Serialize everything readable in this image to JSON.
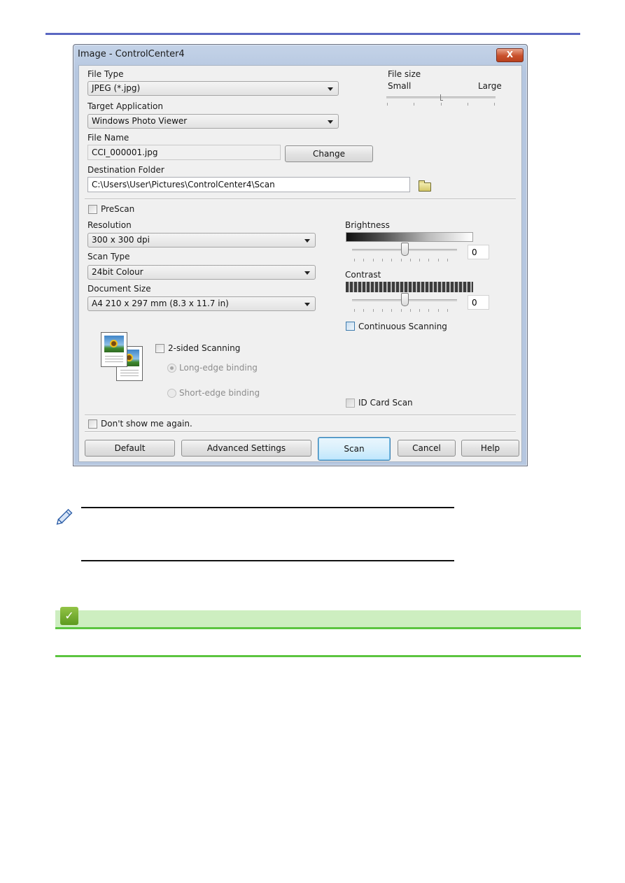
{
  "dialog": {
    "title": "Image - ControlCenter4",
    "close_label": "X",
    "file_type": {
      "label": "File Type",
      "value": "JPEG (*.jpg)"
    },
    "file_size": {
      "label": "File size",
      "min_label": "Small",
      "max_label": "Large",
      "level_fraction": 0.5
    },
    "target_application": {
      "label": "Target Application",
      "value": "Windows Photo Viewer"
    },
    "file_name": {
      "label": "File Name",
      "value": "CCI_000001.jpg",
      "change_button": "Change"
    },
    "destination_folder": {
      "label": "Destination Folder",
      "value": "C:\\Users\\User\\Pictures\\ControlCenter4\\Scan",
      "browse_icon": "folder-icon"
    },
    "prescan": {
      "label": "PreScan",
      "checked": false
    },
    "resolution": {
      "label": "Resolution",
      "value": "300 x 300 dpi"
    },
    "scan_type": {
      "label": "Scan Type",
      "value": "24bit Colour"
    },
    "document_size": {
      "label": "Document Size",
      "value": "A4 210 x 297 mm (8.3 x 11.7 in)"
    },
    "brightness": {
      "label": "Brightness",
      "value": "0",
      "level_fraction": 0.5
    },
    "contrast": {
      "label": "Contrast",
      "value": "0",
      "level_fraction": 0.5
    },
    "continuous_scanning": {
      "label": "Continuous Scanning",
      "checked": false
    },
    "two_sided": {
      "label": "2-sided Scanning",
      "checked": false,
      "long_edge": "Long-edge binding",
      "short_edge": "Short-edge binding",
      "selected": "Long-edge binding"
    },
    "id_card_scan": {
      "label": "ID Card Scan",
      "checked": false
    },
    "dont_show": {
      "label": "Don't show me again.",
      "checked": false
    },
    "buttons": {
      "default": "Default",
      "advanced": "Advanced Settings",
      "scan": "Scan",
      "cancel": "Cancel",
      "help": "Help"
    }
  },
  "colors": {
    "top_rule": "#5b68c2",
    "note_green_bar": "#cdeec0",
    "note_green_line": "#5cc540"
  }
}
